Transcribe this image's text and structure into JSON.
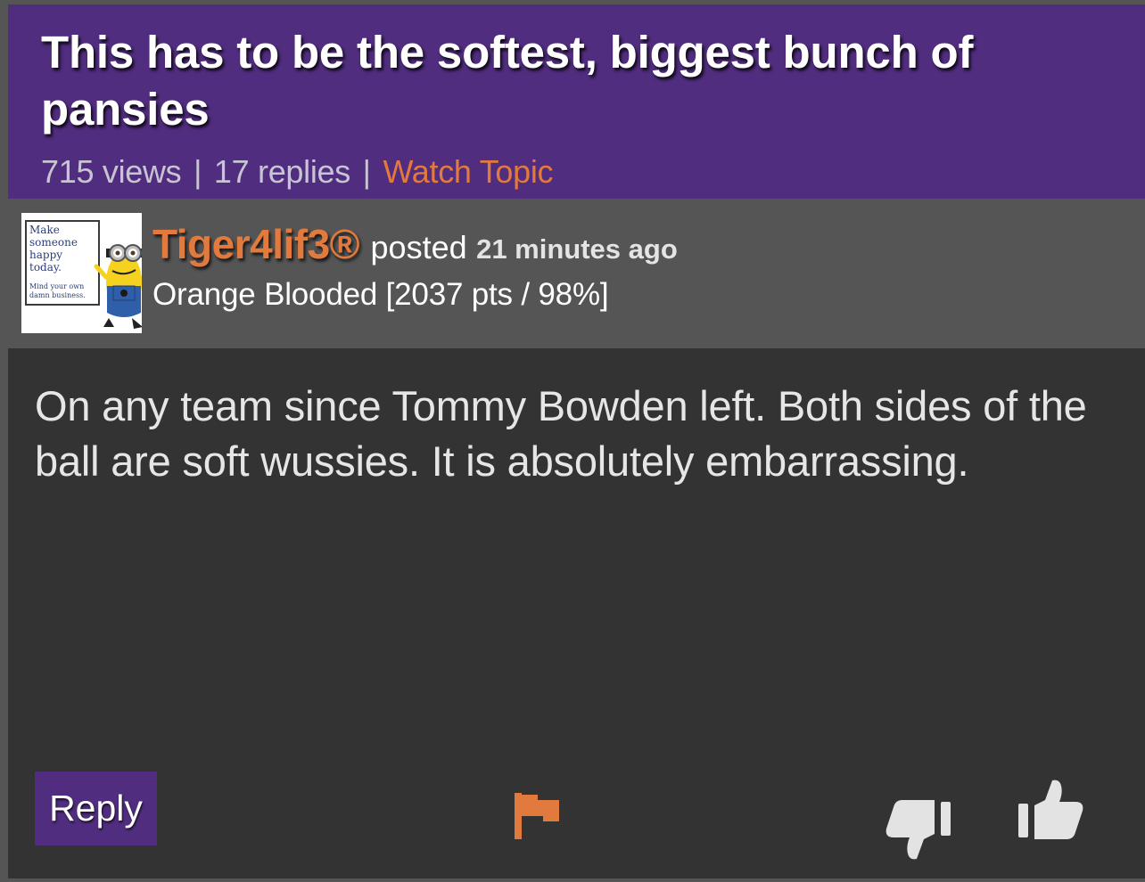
{
  "topic": {
    "title": "This has to be the softest, biggest bunch of pansies",
    "views": "715 views",
    "separator": "|",
    "replies": "17 replies",
    "watch_label": "Watch Topic"
  },
  "post": {
    "author": "Tiger4lif3®",
    "posted_word": "posted",
    "posted_time": "21 minutes ago",
    "rank": "Orange Blooded [2037 pts / 98%]",
    "avatar": {
      "line1": "Make someone happy today.",
      "line2": "Mind your own damn business."
    },
    "body": "On any team since Tommy Bowden left. Both sides of the ball are soft wussies. It is absolutely embarrassing.",
    "actions": {
      "reply_label": "Reply",
      "flag_icon": "flag-icon",
      "thumbs_down_icon": "thumbs-down-icon",
      "thumbs_up_icon": "thumbs-up-icon"
    }
  },
  "colors": {
    "header_purple": "#502d7e",
    "accent_orange": "#e2793d",
    "body_bg": "#333333",
    "author_bar_bg": "#555555"
  }
}
